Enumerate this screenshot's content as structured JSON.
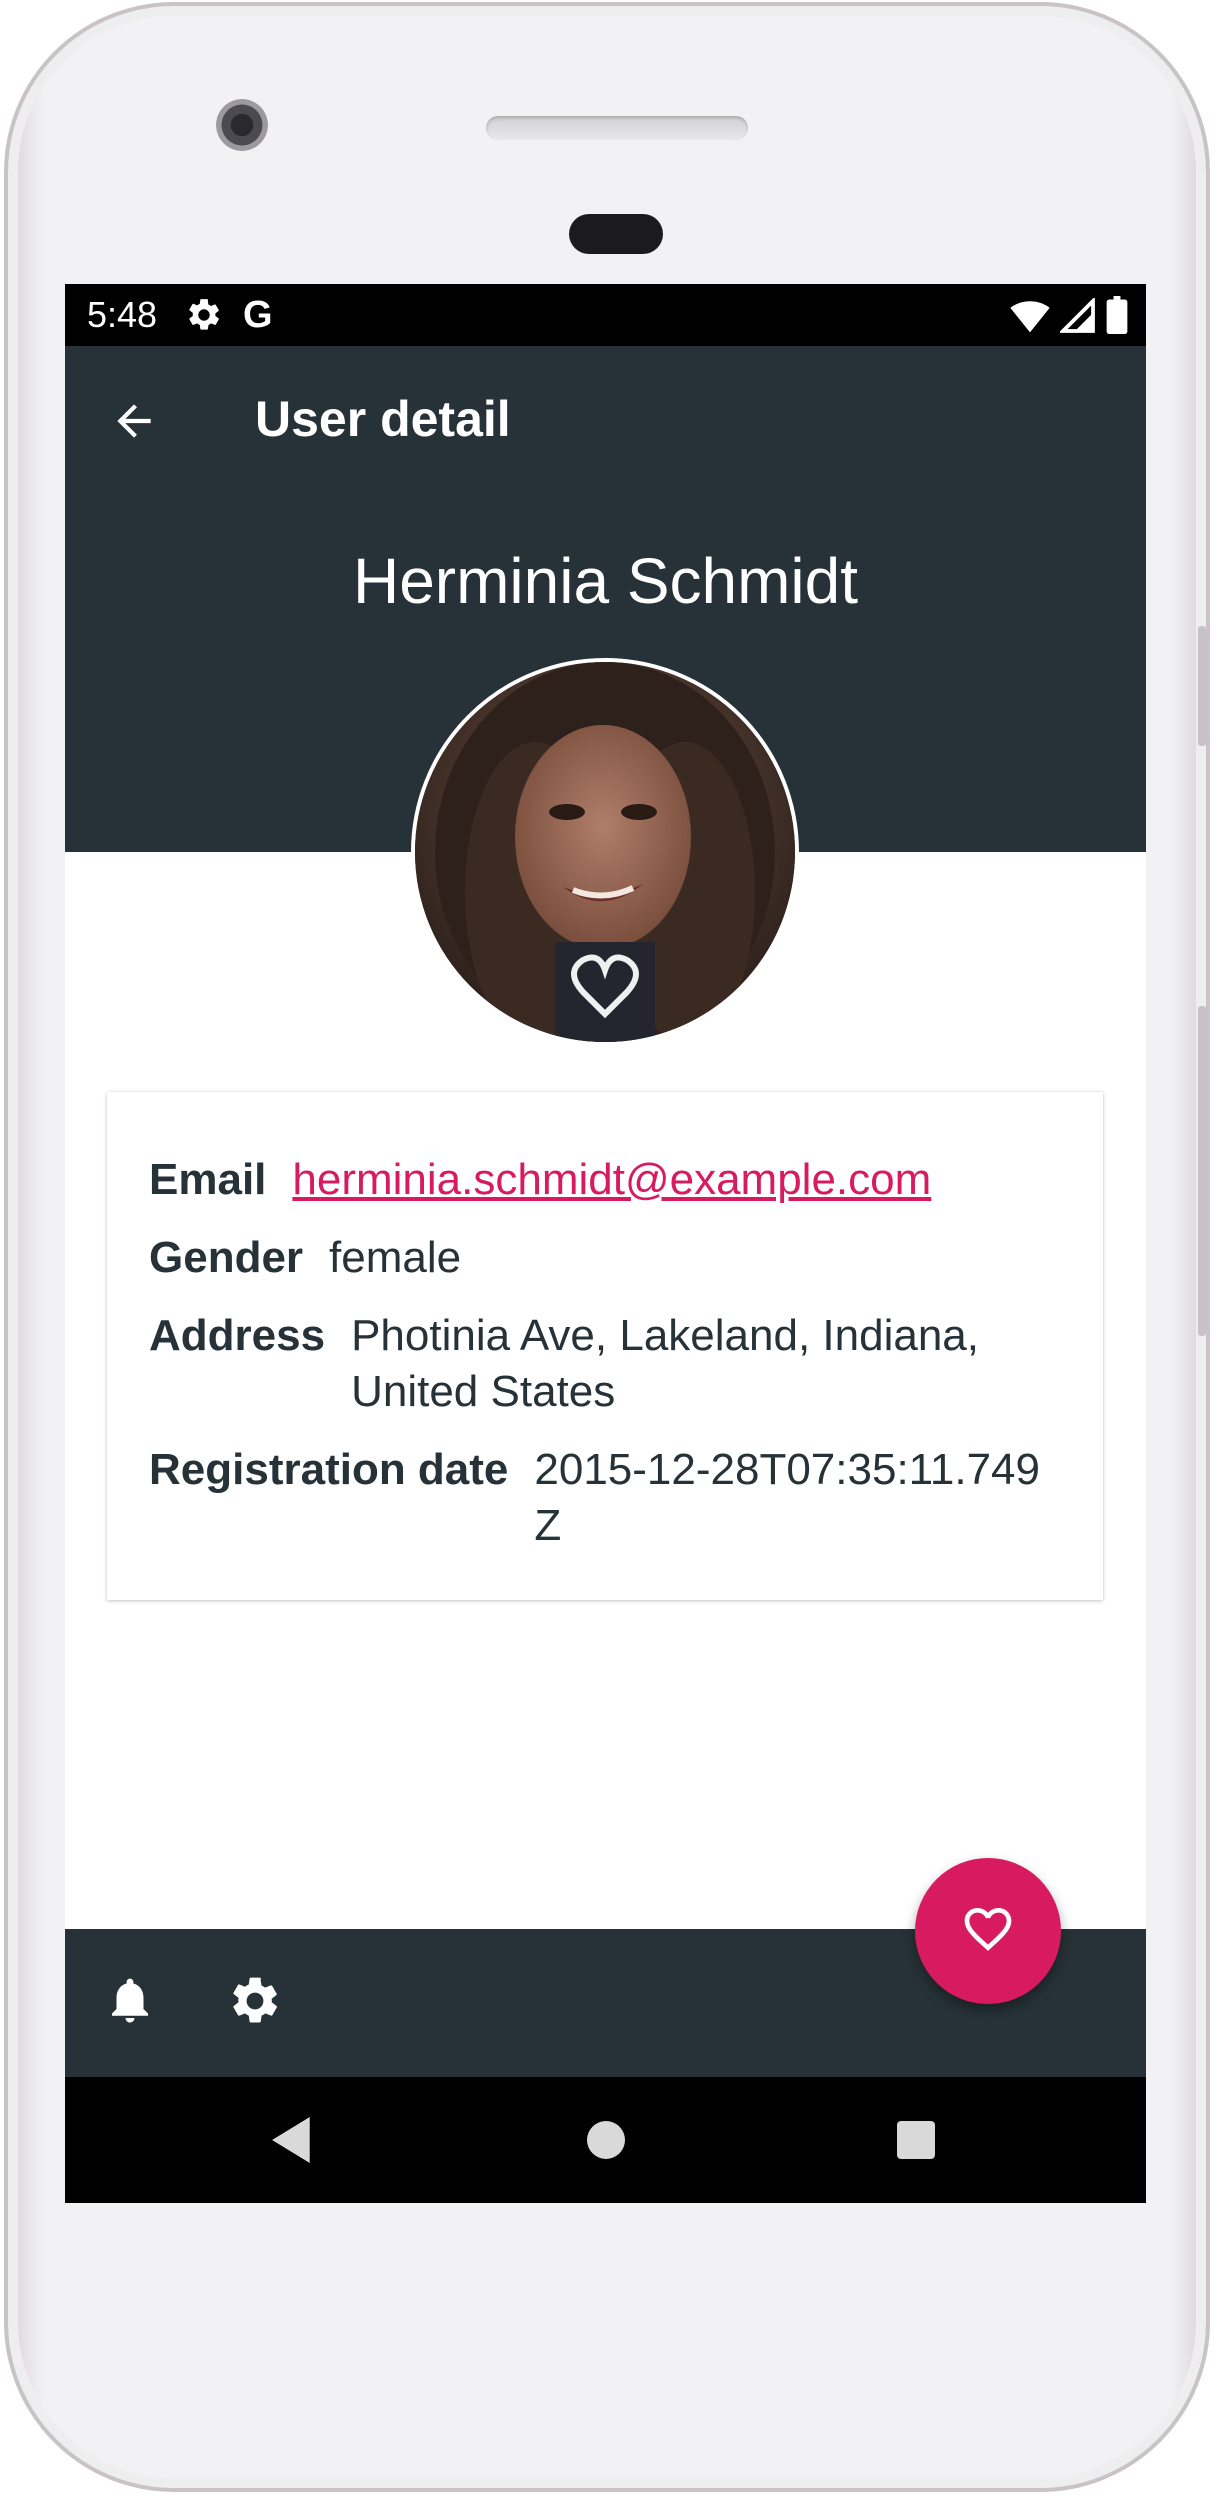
{
  "status_bar": {
    "time": "5:48",
    "google_glyph": "G",
    "icons": [
      "gear-icon",
      "google-icon",
      "wifi-icon",
      "signal-icon",
      "battery-icon"
    ]
  },
  "app_bar": {
    "title": "User detail",
    "back_icon": "arrow-back-icon"
  },
  "profile": {
    "name": "Herminia Schmidt",
    "avatar": "avatar-photo"
  },
  "details": {
    "email_label": "Email",
    "email_value": "herminia.schmidt@example.com",
    "gender_label": "Gender",
    "gender_value": "female",
    "address_label": "Address",
    "address_value": "Photinia Ave, Lakeland, Indiana, United States",
    "registration_label": "Registration date",
    "registration_value": "2015-12-28T07:35:11.749Z"
  },
  "bottom_bar": {
    "icons": [
      "bell-icon",
      "settings-icon"
    ]
  },
  "fab": {
    "icon": "heart-outline-icon"
  },
  "nav_bar": {
    "icons": [
      "nav-back-icon",
      "nav-home-icon",
      "nav-recents-icon"
    ]
  },
  "colors": {
    "primary": "#263238",
    "accent": "#d81b60",
    "text": "#263238",
    "background": "#ffffff"
  }
}
